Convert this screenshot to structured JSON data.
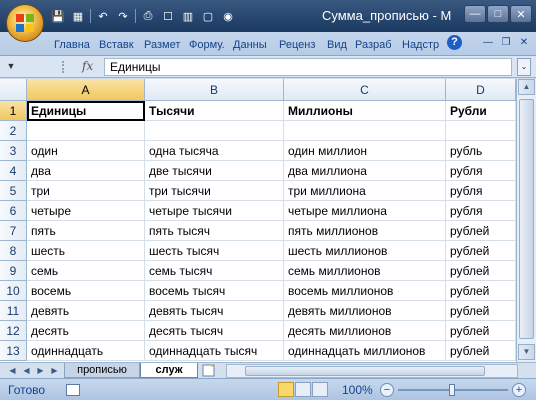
{
  "window": {
    "title": "Сумма_прописью - M"
  },
  "quick_access": {
    "icons": [
      "save-icon",
      "save-as-icon",
      "undo-icon",
      "redo-icon",
      "print-icon",
      "preview-icon",
      "open-icon",
      "new-icon",
      "options-icon"
    ]
  },
  "ribbon": {
    "tabs": [
      "Главна",
      "Вставк",
      "Размет",
      "Форму.",
      "Данны",
      "Реценз",
      "Вид",
      "Разраб",
      "Надстр"
    ],
    "help_label": "?"
  },
  "formula_bar": {
    "fx_label": "fx",
    "value": "Единицы"
  },
  "grid": {
    "columns": [
      "A",
      "B",
      "C",
      "D"
    ],
    "selected_column": "A",
    "rows": [
      {
        "n": "1",
        "cells": [
          "Единицы",
          "Тысячи",
          "Миллионы",
          "Рубли"
        ],
        "bold": true
      },
      {
        "n": "2",
        "cells": [
          "",
          "",
          "",
          ""
        ]
      },
      {
        "n": "3",
        "cells": [
          "один",
          "одна тысяча",
          "один миллион",
          "рубль"
        ]
      },
      {
        "n": "4",
        "cells": [
          "два",
          "две тысячи",
          "два миллиона",
          "рубля"
        ]
      },
      {
        "n": "5",
        "cells": [
          "три",
          "три тысячи",
          "три миллиона",
          "рубля"
        ]
      },
      {
        "n": "6",
        "cells": [
          "четыре",
          "четыре тысячи",
          "четыре миллиона",
          "рубля"
        ]
      },
      {
        "n": "7",
        "cells": [
          "пять",
          "пять тысяч",
          "пять миллионов",
          "рублей"
        ]
      },
      {
        "n": "8",
        "cells": [
          "шесть",
          "шесть тысяч",
          "шесть миллионов",
          "рублей"
        ]
      },
      {
        "n": "9",
        "cells": [
          "семь",
          "семь тысяч",
          "семь миллионов",
          "рублей"
        ]
      },
      {
        "n": "10",
        "cells": [
          "восемь",
          "восемь тысяч",
          "восемь миллионов",
          "рублей"
        ]
      },
      {
        "n": "11",
        "cells": [
          "девять",
          "девять тысяч",
          "девять миллионов",
          "рублей"
        ]
      },
      {
        "n": "12",
        "cells": [
          "десять",
          "десять тысяч",
          "десять миллионов",
          "рублей"
        ]
      },
      {
        "n": "13",
        "cells": [
          "одиннадцать",
          "одиннадцать тысяч",
          "одиннадцать миллионов",
          "рублей"
        ]
      }
    ]
  },
  "sheets": {
    "tabs": [
      "прописью",
      "служ"
    ],
    "active": "служ"
  },
  "status": {
    "ready": "Готово",
    "zoom": "100%"
  },
  "colors": {
    "title_bar": "#2a4a73",
    "ribbon": "#c5d6ec",
    "selected_header": "#f3c75b",
    "text_blue": "#15428b"
  }
}
